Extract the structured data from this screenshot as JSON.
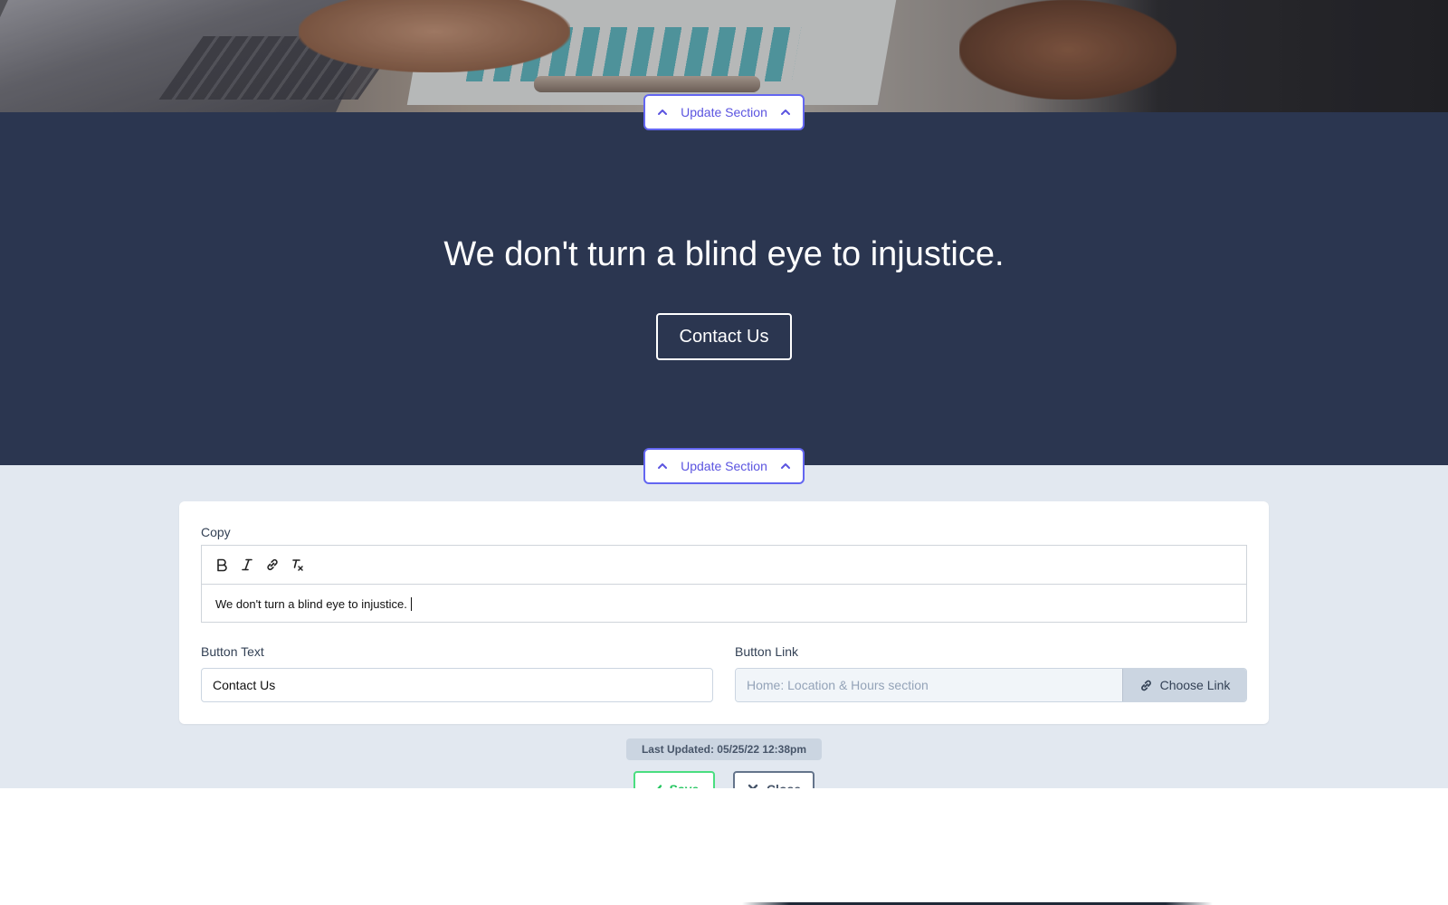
{
  "hero": {
    "update_section_label": "Update Section"
  },
  "cta": {
    "heading": "We don't turn a blind eye to injustice.",
    "button_label": "Contact Us",
    "update_section_label": "Update Section",
    "background_color": "#2b3650"
  },
  "editor": {
    "copy_label": "Copy",
    "toolbar": {
      "items": [
        "bold-icon",
        "italic-icon",
        "link-icon",
        "clear-format-icon"
      ]
    },
    "copy_value": "We don't turn a blind eye to injustice.",
    "button_text_label": "Button Text",
    "button_text_value": "Contact Us",
    "button_link_label": "Button Link",
    "button_link_value": "Home: Location & Hours section",
    "choose_link_label": "Choose Link",
    "last_updated": "Last Updated: 05/25/22 12:38pm",
    "save_label": "Save",
    "close_label": "Close"
  },
  "colors": {
    "accent": "#6366f1",
    "save": "#22c55e",
    "editor_bg": "#e2e8f0"
  }
}
